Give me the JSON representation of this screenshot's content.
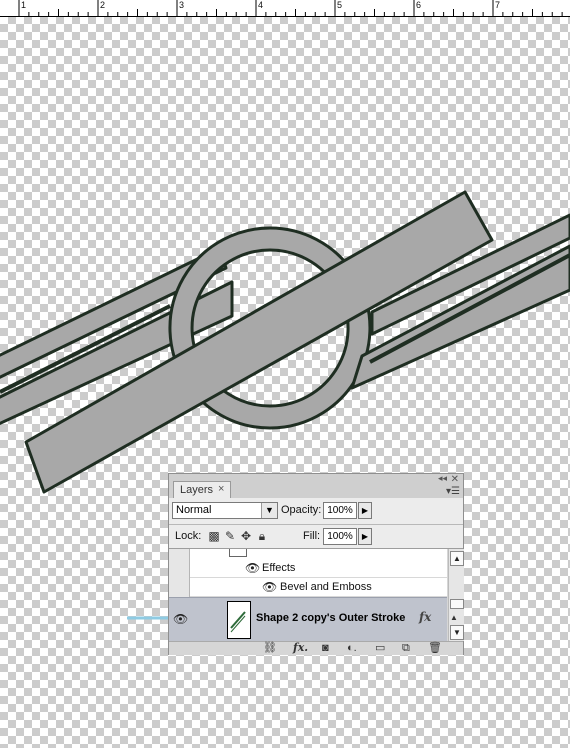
{
  "ruler": {
    "ticks": [
      "1",
      "2",
      "3",
      "4",
      "5",
      "6",
      "7"
    ]
  },
  "layers_panel": {
    "tab_label": "Layers",
    "tab_close": "×",
    "blend_mode": "Normal",
    "opacity_label": "Opacity:",
    "opacity_value": "100%",
    "lock_label": "Lock:",
    "fill_label": "Fill:",
    "fill_value": "100%",
    "effects_label": "Effects",
    "effect_item": "Bevel and Emboss",
    "selected_layer": "Shape 2 copy's Outer Stroke",
    "fx_badge": "fx"
  },
  "icons": {
    "eye": "eye-icon",
    "lock_transparent": "lock-transparent-icon",
    "lock_paint": "brush-icon",
    "lock_move": "move-icon",
    "lock_all": "padlock-icon",
    "link": "link-icon",
    "fx": "fx-icon",
    "mask": "mask-icon",
    "adjustment": "adjustment-icon",
    "group": "folder-icon",
    "new_layer": "new-layer-icon",
    "trash": "trash-icon"
  },
  "colors": {
    "shape_fill": "#a8a8a8",
    "shape_stroke": "#1f2e22",
    "selected_row": "#bfc3cd",
    "pointer_arrow": "#8ecbe3"
  }
}
